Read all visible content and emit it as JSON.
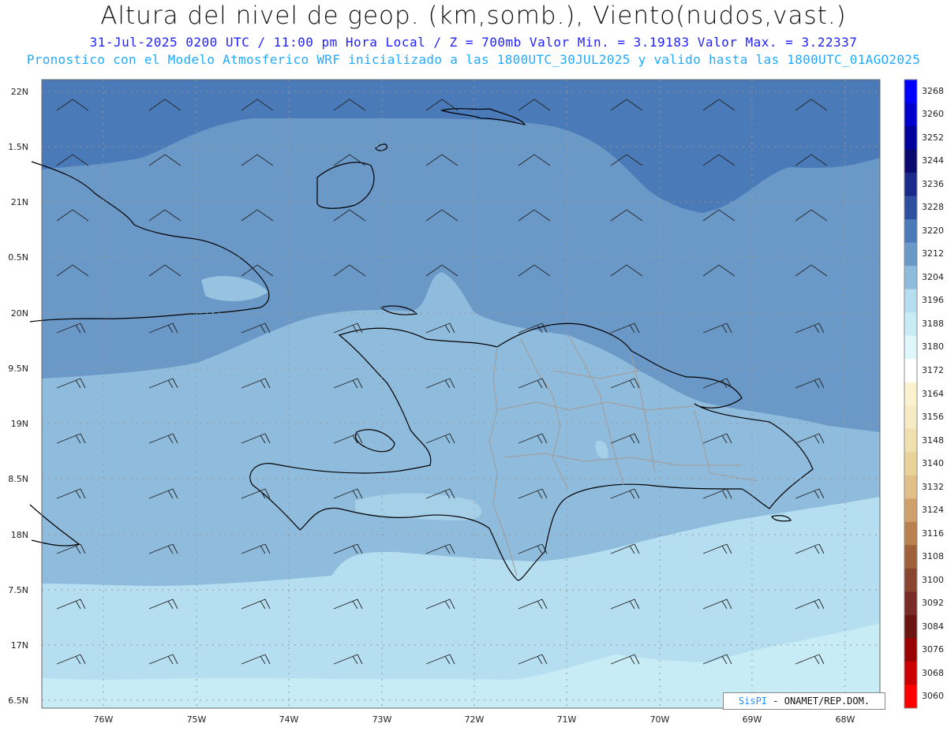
{
  "title": "Altura del nivel de geop. (km,somb.), Viento(nudos,vast.)",
  "subtitle_line1": "31-Jul-2025  0200 UTC / 11:00 pm Hora Local / Z = 700mb   Valor Min. = 3.19183  Valor Max. = 3.22337",
  "subtitle_line2": "Pronostico con el Modelo Atmosferico WRF inicializado a las 1800UTC_30JUL2025 y valido hasta las  1800UTC_01AGO2025",
  "lat_labels": [
    "22N",
    "1.5N",
    "21N",
    "0.5N",
    "20N",
    "9.5N",
    "19N",
    "8.5N",
    "18N",
    "7.5N",
    "17N",
    "6.5N"
  ],
  "lon_labels": [
    "76W",
    "75W",
    "74W",
    "73W",
    "72W",
    "71W",
    "70W",
    "69W",
    "68W"
  ],
  "colorbar": {
    "labels": [
      "3268",
      "3260",
      "3252",
      "3244",
      "3236",
      "3228",
      "3220",
      "3212",
      "3204",
      "3196",
      "3188",
      "3180",
      "3172",
      "3164",
      "3156",
      "3148",
      "3140",
      "3132",
      "3124",
      "3116",
      "3108",
      "3100",
      "3092",
      "3084",
      "3076",
      "3068",
      "3060"
    ],
    "colors": [
      "#0000ff",
      "#0000cc",
      "#00009a",
      "#0a0a6e",
      "#1a2a8a",
      "#2e4fa0",
      "#4a7ab8",
      "#6a99c8",
      "#8fbbdc",
      "#b5def0",
      "#c8ecf6",
      "#dff6fb",
      "#ffffff",
      "#fbf2cf",
      "#f6ebc4",
      "#f0e0b0",
      "#ead39a",
      "#e0c088",
      "#cfa06a",
      "#b9814e",
      "#a0603a",
      "#8a4530",
      "#7a2a28",
      "#6a1510",
      "#990000",
      "#cc0000",
      "#ff0000"
    ]
  },
  "credit": {
    "logo": "SisPI",
    "text": "- ONAMET/REP.DOM."
  },
  "field_colors": {
    "highest": "#4a7ab8",
    "high": "#6a99c8",
    "mid": "#8fbbdc",
    "low": "#b5def0",
    "lowest": "#c8ecf6"
  }
}
